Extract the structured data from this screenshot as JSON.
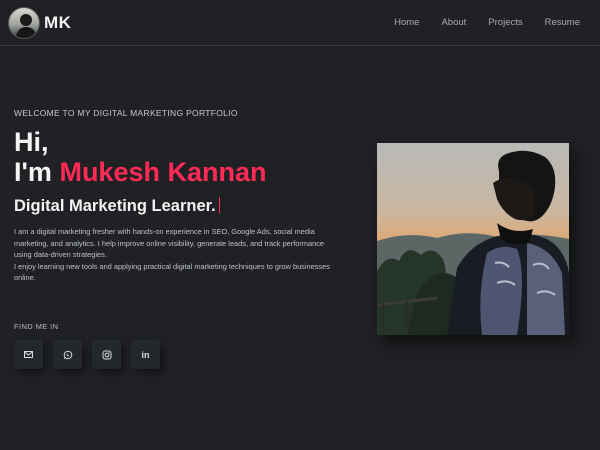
{
  "header": {
    "brand": "MK",
    "nav": [
      {
        "label": "Home"
      },
      {
        "label": "About"
      },
      {
        "label": "Projects"
      },
      {
        "label": "Resume"
      }
    ]
  },
  "hero": {
    "welcome": "WELCOME TO MY DIGITAL MARKETING PORTFOLIO",
    "greeting": "Hi,",
    "im": "I'm",
    "name": "Mukesh Kannan",
    "role": "Digital Marketing Learner.",
    "description": [
      "I am a digital marketing fresher with hands-on experience in SEO, Google Ads, social media marketing, and analytics. I help improve online visibility, generate leads, and track performance using data-driven strategies.",
      "I enjoy learning new tools and applying practical digital marketing techniques to grow businesses online."
    ],
    "find_me": "FIND ME IN",
    "socials": [
      {
        "icon": "mail-icon"
      },
      {
        "icon": "whatsapp-icon"
      },
      {
        "icon": "instagram-icon"
      },
      {
        "icon": "linkedin-icon",
        "label": "in"
      }
    ]
  },
  "colors": {
    "background": "#1f2124",
    "accent": "#ff2a55",
    "text": "#f4f4f4"
  }
}
